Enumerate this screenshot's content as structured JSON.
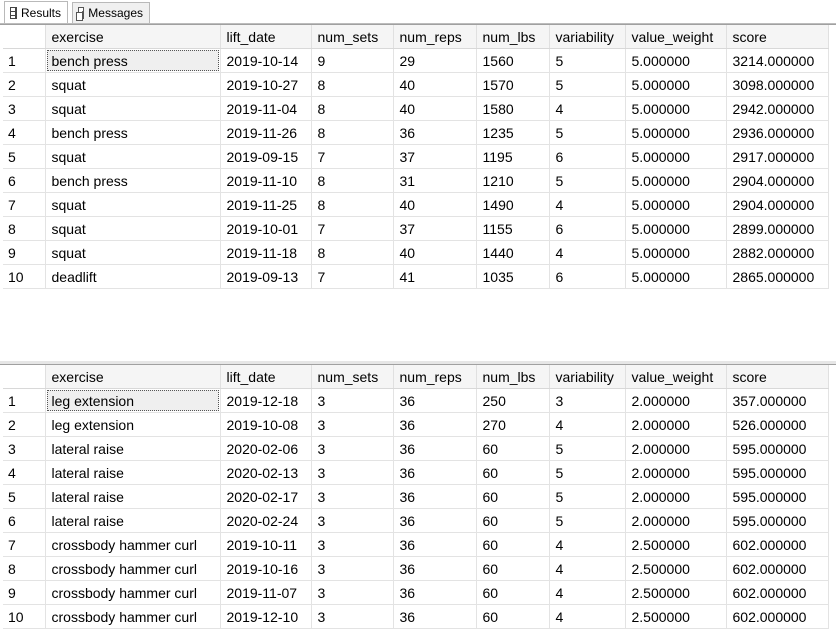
{
  "tabs": [
    {
      "label": "Results",
      "icon": "grid-icon",
      "active": true
    },
    {
      "label": "Messages",
      "icon": "messages-icon",
      "active": false
    }
  ],
  "columns": [
    "exercise",
    "lift_date",
    "num_sets",
    "num_reps",
    "num_lbs",
    "variability",
    "value_weight",
    "score"
  ],
  "grid1": {
    "rows": [
      [
        "1",
        "bench press",
        "2019-10-14",
        "9",
        "29",
        "1560",
        "5",
        "5.000000",
        "3214.000000"
      ],
      [
        "2",
        "squat",
        "2019-10-27",
        "8",
        "40",
        "1570",
        "5",
        "5.000000",
        "3098.000000"
      ],
      [
        "3",
        "squat",
        "2019-11-04",
        "8",
        "40",
        "1580",
        "4",
        "5.000000",
        "2942.000000"
      ],
      [
        "4",
        "bench press",
        "2019-11-26",
        "8",
        "36",
        "1235",
        "5",
        "5.000000",
        "2936.000000"
      ],
      [
        "5",
        "squat",
        "2019-09-15",
        "7",
        "37",
        "1195",
        "6",
        "5.000000",
        "2917.000000"
      ],
      [
        "6",
        "bench press",
        "2019-11-10",
        "8",
        "31",
        "1210",
        "5",
        "5.000000",
        "2904.000000"
      ],
      [
        "7",
        "squat",
        "2019-11-25",
        "8",
        "40",
        "1490",
        "4",
        "5.000000",
        "2904.000000"
      ],
      [
        "8",
        "squat",
        "2019-10-01",
        "7",
        "37",
        "1155",
        "6",
        "5.000000",
        "2899.000000"
      ],
      [
        "9",
        "squat",
        "2019-11-18",
        "8",
        "40",
        "1440",
        "4",
        "5.000000",
        "2882.000000"
      ],
      [
        "10",
        "deadlift",
        "2019-09-13",
        "7",
        "41",
        "1035",
        "6",
        "5.000000",
        "2865.000000"
      ]
    ]
  },
  "grid2": {
    "rows": [
      [
        "1",
        "leg extension",
        "2019-12-18",
        "3",
        "36",
        "250",
        "3",
        "2.000000",
        "357.000000"
      ],
      [
        "2",
        "leg extension",
        "2019-10-08",
        "3",
        "36",
        "270",
        "4",
        "2.000000",
        "526.000000"
      ],
      [
        "3",
        "lateral raise",
        "2020-02-06",
        "3",
        "36",
        "60",
        "5",
        "2.000000",
        "595.000000"
      ],
      [
        "4",
        "lateral raise",
        "2020-02-13",
        "3",
        "36",
        "60",
        "5",
        "2.000000",
        "595.000000"
      ],
      [
        "5",
        "lateral raise",
        "2020-02-17",
        "3",
        "36",
        "60",
        "5",
        "2.000000",
        "595.000000"
      ],
      [
        "6",
        "lateral raise",
        "2020-02-24",
        "3",
        "36",
        "60",
        "5",
        "2.000000",
        "595.000000"
      ],
      [
        "7",
        "crossbody hammer curl",
        "2019-10-11",
        "3",
        "36",
        "60",
        "4",
        "2.500000",
        "602.000000"
      ],
      [
        "8",
        "crossbody hammer curl",
        "2019-10-16",
        "3",
        "36",
        "60",
        "4",
        "2.500000",
        "602.000000"
      ],
      [
        "9",
        "crossbody hammer curl",
        "2019-11-07",
        "3",
        "36",
        "60",
        "4",
        "2.500000",
        "602.000000"
      ],
      [
        "10",
        "crossbody hammer curl",
        "2019-12-10",
        "3",
        "36",
        "60",
        "4",
        "2.500000",
        "602.000000"
      ]
    ]
  }
}
